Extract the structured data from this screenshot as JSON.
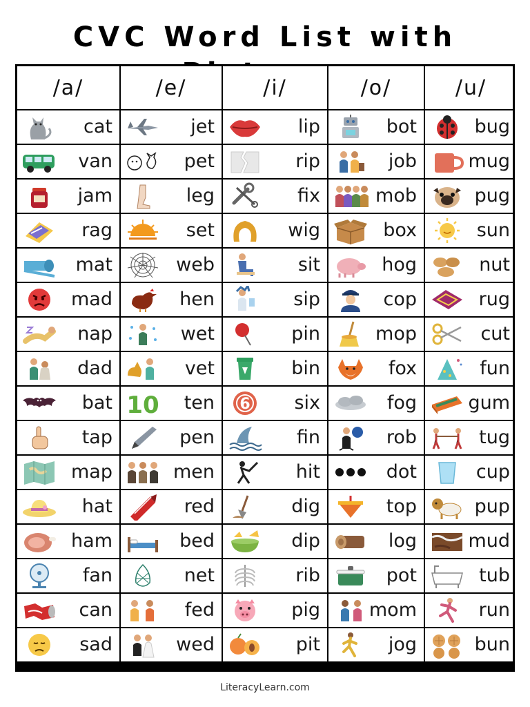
{
  "title": "CVC Word List with Pictures",
  "footer": "LiteracyLearn.com",
  "columns": [
    {
      "header": "/a/",
      "words": [
        "cat",
        "van",
        "jam",
        "rag",
        "mat",
        "mad",
        "nap",
        "dad",
        "bat",
        "tap",
        "map",
        "hat",
        "ham",
        "fan",
        "can",
        "sad"
      ],
      "icons": [
        "cat-icon",
        "van-icon",
        "jam-jar-icon",
        "rag-icon",
        "mat-roll-icon",
        "mad-face-icon",
        "nap-icon",
        "dad-icon",
        "bat-icon",
        "tap-finger-icon",
        "map-icon",
        "sun-hat-icon",
        "ham-icon",
        "fan-icon",
        "crushed-can-icon",
        "sad-face-icon"
      ]
    },
    {
      "header": "/e/",
      "words": [
        "jet",
        "pet",
        "leg",
        "set",
        "web",
        "hen",
        "wet",
        "vet",
        "ten",
        "pen",
        "men",
        "red",
        "bed",
        "net",
        "fed",
        "wed"
      ],
      "icons": [
        "jet-icon",
        "pet-icon",
        "leg-icon",
        "sunset-icon",
        "spider-web-icon",
        "hen-icon",
        "wet-person-icon",
        "vet-icon",
        "number-ten-icon",
        "pen-icon",
        "men-icon",
        "red-crayon-icon",
        "bed-icon",
        "net-icon",
        "feeding-icon",
        "wedding-icon"
      ]
    },
    {
      "header": "/i/",
      "words": [
        "lip",
        "rip",
        "fix",
        "wig",
        "sit",
        "sip",
        "pin",
        "bin",
        "six",
        "fin",
        "hit",
        "dig",
        "dip",
        "rib",
        "pig",
        "pit"
      ],
      "icons": [
        "lips-icon",
        "ripped-paper-icon",
        "wrench-icon",
        "wig-icon",
        "sitting-icon",
        "sipping-icon",
        "push-pin-icon",
        "recycle-bin-icon",
        "number-six-icon",
        "shark-fin-icon",
        "batter-icon",
        "shovel-icon",
        "dip-bowl-icon",
        "ribcage-icon",
        "pig-face-icon",
        "peach-pit-icon"
      ]
    },
    {
      "header": "/o/",
      "words": [
        "bot",
        "job",
        "mob",
        "box",
        "hog",
        "cop",
        "mop",
        "fox",
        "fog",
        "rob",
        "dot",
        "top",
        "log",
        "pot",
        "mom",
        "jog"
      ],
      "icons": [
        "robot-icon",
        "workers-icon",
        "crowd-icon",
        "box-icon",
        "hog-icon",
        "police-icon",
        "mop-icon",
        "fox-icon",
        "fog-icon",
        "robber-icon",
        "dots-icon",
        "spinning-top-icon",
        "log-icon",
        "pot-icon",
        "mother-icon",
        "jogger-icon"
      ]
    },
    {
      "header": "/u/",
      "words": [
        "bug",
        "mug",
        "pug",
        "sun",
        "nut",
        "rug",
        "cut",
        "fun",
        "gum",
        "tug",
        "cup",
        "pup",
        "mud",
        "tub",
        "run",
        "bun"
      ],
      "icons": [
        "ladybug-icon",
        "mug-icon",
        "pug-icon",
        "sun-icon",
        "peanut-icon",
        "rug-icon",
        "scissors-icon",
        "party-hat-icon",
        "gum-pack-icon",
        "tug-of-war-icon",
        "cup-icon",
        "puppy-icon",
        "mud-icon",
        "bathtub-icon",
        "runner-icon",
        "buns-icon"
      ]
    }
  ]
}
